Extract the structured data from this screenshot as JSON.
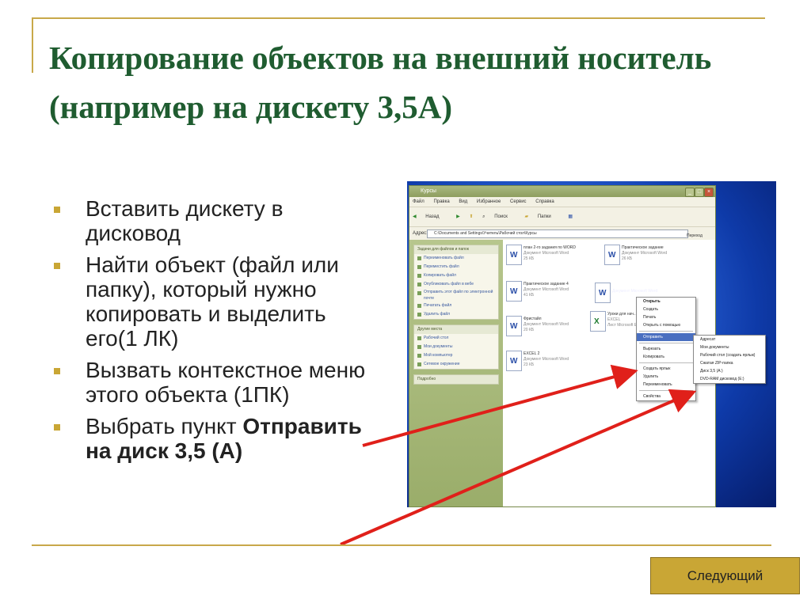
{
  "slide": {
    "title": "Копирование объектов на внешний носитель (например на дискету 3,5А)",
    "steps": [
      {
        "text": "Вставить дискету в дисковод"
      },
      {
        "text": "Найти объект (файл или папку), который нужно копировать и выделить его(1 ЛК)"
      },
      {
        "text": "Вызвать контекстное меню этого объекта (1ПК)"
      },
      {
        "text_prefix": "Выбрать пункт ",
        "text_bold": "Отправить на диск 3,5 (А)"
      }
    ],
    "next_button": "Следующий",
    "colors": {
      "title": "#1f5c30",
      "accent": "#c9a635",
      "arrow": "#e0201a",
      "frame": "#c8a84a"
    }
  },
  "screenshot": {
    "window_title": "Курсы",
    "menu": [
      "Файл",
      "Правка",
      "Вид",
      "Избранное",
      "Сервис",
      "Справка"
    ],
    "toolbar": [
      "Назад",
      "Поиск",
      "Папки"
    ],
    "address_label": "Адрес:",
    "address": "C:\\Documents and Settings\\Учитель\\Рабочий стол\\Курсы",
    "go": "Переход",
    "tasks_head": "Задачи для файлов и папок",
    "tasks": [
      "Переименовать файл",
      "Переместить файл",
      "Копировать файл",
      "Опубликовать файл в вебе",
      "Отправить этот файл по электронной почте",
      "Печатать файл",
      "Удалить файл"
    ],
    "places_head": "Другие места",
    "places": [
      "Рабочий стол",
      "Мои документы",
      "Мой компьютер",
      "Сетевое окружение"
    ],
    "details_head": "Подробно",
    "files": [
      {
        "name": "план 2-го задания по WORD",
        "type": "Документ Microsoft Word",
        "size": "25 КБ"
      },
      {
        "name": "Практическое задание",
        "type": "Документ Microsoft Word",
        "size": "26 КБ"
      },
      {
        "name": "Практическое задание 4",
        "type": "Документ Microsoft Word",
        "size": "41 КБ"
      },
      {
        "name": "Урок 2",
        "type": "Документ Microsoft Word",
        "size": ""
      },
      {
        "name": "Фристайл",
        "type": "Документ Microsoft Word",
        "size": "20 КБ"
      },
      {
        "name": "Уроки для нач...",
        "type": "Лист Microsoft Excel",
        "size": "EXCEL"
      },
      {
        "name": "EXCEL 2",
        "type": "Документ Microsoft Word",
        "size": "23 КБ"
      }
    ],
    "context_menu": [
      "Открыть",
      "Создать",
      "Печать",
      "Открыть с помощью",
      "Отправить",
      "Вырезать",
      "Копировать",
      "Создать ярлык",
      "Удалить",
      "Переименовать",
      "Свойства"
    ],
    "send_to_menu": [
      "Адресат",
      "Мои документы",
      "Рабочий стол (создать ярлык)",
      "Сжатая ZIP-папка",
      "Диск 3,5 (A:)",
      "DVD-RAM дисковод (E:)"
    ]
  }
}
